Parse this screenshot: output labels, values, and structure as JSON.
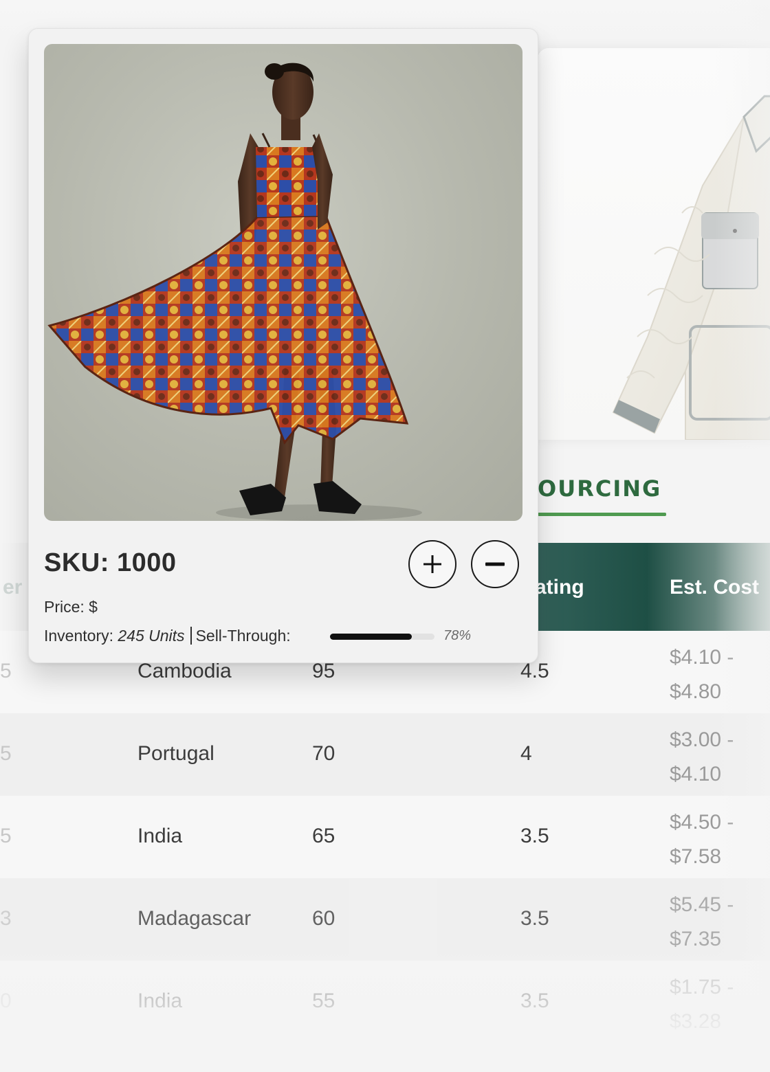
{
  "product": {
    "sku_label": "SKU: 1000",
    "price_label": "Price: $",
    "inventory_label": "Inventory: ",
    "inventory_value": "245 Units",
    "sell_through_label": "Sell-Through:",
    "sell_through_percent": 78,
    "sell_through_text": "78%",
    "image_icon": "dress-photo"
  },
  "controls": {
    "add_icon": "plus-icon",
    "remove_icon": "minus-icon"
  },
  "sourcing": {
    "tab_label": "OURCING",
    "accent_color": "#4f9a50",
    "header_color": "#2f5e56",
    "columns": {
      "partial_left": "er",
      "rating": "ating",
      "cost": "Est. Cost"
    },
    "rows": [
      {
        "score": "5",
        "country": "Cambodia",
        "reliability": "95",
        "rating": "4.5",
        "cost_low": "$4.10 -",
        "cost_high": "$4.80"
      },
      {
        "score": "5",
        "country": "Portugal",
        "reliability": "70",
        "rating": "4",
        "cost_low": "$3.00 -",
        "cost_high": "$4.10"
      },
      {
        "score": "5",
        "country": "India",
        "reliability": "65",
        "rating": "3.5",
        "cost_low": "$4.50 -",
        "cost_high": "$7.58"
      },
      {
        "score": "3",
        "country": "Madagascar",
        "reliability": "60",
        "rating": "3.5",
        "cost_low": "$5.45 -",
        "cost_high": "$7.35"
      },
      {
        "score": "0",
        "country": "India",
        "reliability": "55",
        "rating": "3.5",
        "cost_low": "$1.75 -",
        "cost_high": "$3.28"
      }
    ]
  }
}
